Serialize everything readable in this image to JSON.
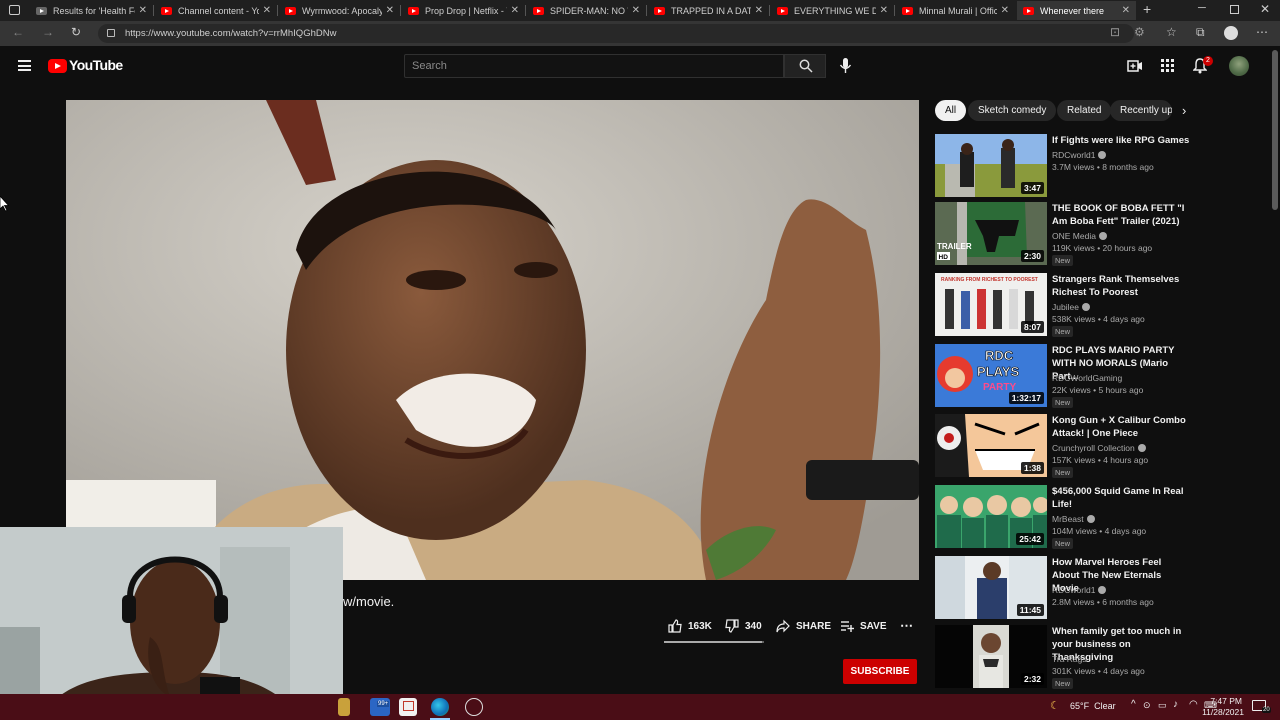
{
  "browser": {
    "tabs": [
      {
        "title": "Results for 'Health Fo",
        "favicon": "gray",
        "active": false
      },
      {
        "title": "Channel content - You",
        "favicon": "youtube",
        "active": false
      },
      {
        "title": "Wyrmwood: Apocalyp",
        "favicon": "youtube",
        "active": false
      },
      {
        "title": "Prop Drop | Netflix - Y",
        "favicon": "youtube",
        "active": false
      },
      {
        "title": "SPIDER-MAN: NO WA",
        "favicon": "youtube",
        "active": false
      },
      {
        "title": "TRAPPED IN A DATIN",
        "favicon": "youtube",
        "active": false
      },
      {
        "title": "EVERYTHING WE DO",
        "favicon": "youtube",
        "active": false
      },
      {
        "title": "Minnal Murali | Offici",
        "favicon": "youtube",
        "active": false
      },
      {
        "title": "Whenever there",
        "favicon": "youtube",
        "active": true
      }
    ],
    "url": "https://www.youtube.com/watch?v=rrMhIQGhDNw"
  },
  "header": {
    "logo_text": "YouTube",
    "search_placeholder": "Search",
    "notification_count": "2"
  },
  "video": {
    "title_visible": "w/movie.",
    "likes": "163K",
    "dislikes": "340",
    "like_ratio": 0.98,
    "share_label": "SHARE",
    "save_label": "SAVE",
    "subscribe_label": "SUBSCRIBE"
  },
  "chips": [
    "All",
    "Sketch comedy",
    "Related",
    "Recently up"
  ],
  "recommendations": [
    {
      "title": "If Fights were like RPG Games",
      "channel": "RDCworld1",
      "verified": true,
      "meta": "3.7M views • 8 months ago",
      "duration": "3:47",
      "new": false
    },
    {
      "title": "THE BOOK OF BOBA FETT \"I Am Boba Fett\" Trailer (2021)",
      "channel": "ONE Media",
      "verified": true,
      "meta": "119K views • 20 hours ago",
      "duration": "2:30",
      "new": true
    },
    {
      "title": "Strangers Rank Themselves Richest To Poorest",
      "channel": "Jubilee",
      "verified": true,
      "meta": "538K views • 4 days ago",
      "duration": "8:07",
      "new": true
    },
    {
      "title": "RDC PLAYS MARIO PARTY WITH NO MORALS (Mario Part...",
      "channel": "RDCWorldGaming",
      "verified": false,
      "meta": "22K views • 5 hours ago",
      "duration": "1:32:17",
      "new": true
    },
    {
      "title": "Kong Gun + X Calibur Combo Attack! | One Piece",
      "channel": "Crunchyroll Collection",
      "verified": true,
      "meta": "157K views • 4 hours ago",
      "duration": "1:38",
      "new": true
    },
    {
      "title": "$456,000 Squid Game In Real Life!",
      "channel": "MrBeast",
      "verified": true,
      "meta": "104M views • 4 days ago",
      "duration": "25:42",
      "new": true
    },
    {
      "title": "How Marvel Heroes Feel About The New Eternals Movie",
      "channel": "RDCworld1",
      "verified": true,
      "meta": "2.8M views • 6 months ago",
      "duration": "11:45",
      "new": false
    },
    {
      "title": "When family get too much in your business on Thanksgiving",
      "channel": "Tra Rags",
      "verified": false,
      "meta": "301K views • 4 days ago",
      "duration": "2:32",
      "new": true
    }
  ],
  "thumb_labels": {
    "trailer": "TRAILER",
    "hd": "HD",
    "rank": "RANKING FROM RICHEST TO POOREST",
    "rdc": "RDC",
    "plays": "PLAYS",
    "party": "PARTY"
  },
  "taskbar": {
    "badge": "99+",
    "weather": "65°F  Clear",
    "time": "7:47 PM",
    "date": "11/28/2021",
    "notifications": "20"
  }
}
